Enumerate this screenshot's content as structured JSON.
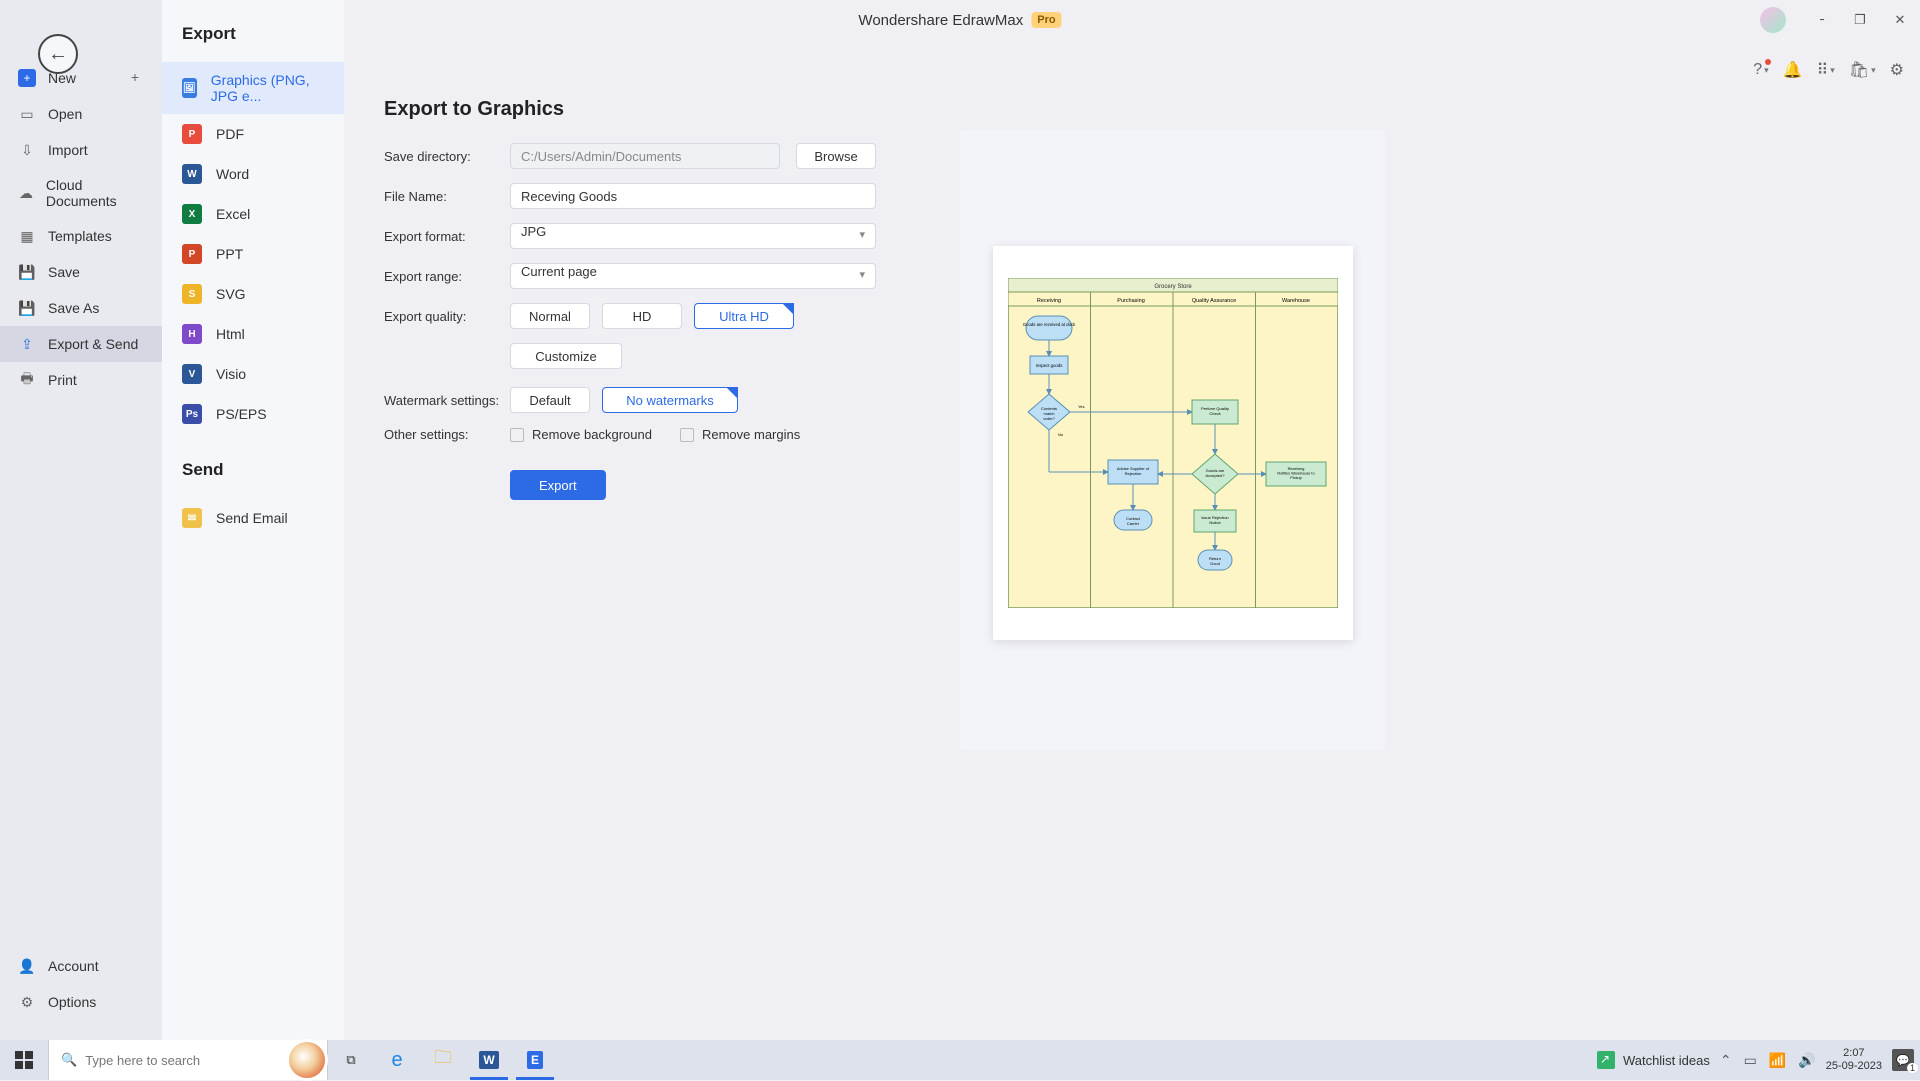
{
  "titlebar": {
    "app": "Wondershare EdrawMax",
    "badge": "Pro"
  },
  "back_aria": "Back",
  "leftnav": {
    "new": "New",
    "open": "Open",
    "import": "Import",
    "cloud": "Cloud Documents",
    "templates": "Templates",
    "save": "Save",
    "saveas": "Save As",
    "exportsend": "Export & Send",
    "print": "Print",
    "account": "Account",
    "options": "Options"
  },
  "typecol": {
    "export_heading": "Export",
    "graphics": "Graphics (PNG, JPG e...",
    "pdf": "PDF",
    "word": "Word",
    "excel": "Excel",
    "ppt": "PPT",
    "svg": "SVG",
    "html": "Html",
    "visio": "Visio",
    "pseps": "PS/EPS",
    "send_heading": "Send",
    "email": "Send Email"
  },
  "form": {
    "title": "Export to Graphics",
    "savedir_label": "Save directory:",
    "savedir_value": "C:/Users/Admin/Documents",
    "browse": "Browse",
    "filename_label": "File Name:",
    "filename_value": "Receving Goods",
    "format_label": "Export format:",
    "format_value": "JPG",
    "range_label": "Export range:",
    "range_value": "Current page",
    "quality_label": "Export quality:",
    "quality_normal": "Normal",
    "quality_hd": "HD",
    "quality_ultra": "Ultra HD",
    "customize": "Customize",
    "watermark_label": "Watermark settings:",
    "wm_default": "Default",
    "wm_none": "No watermarks",
    "other_label": "Other settings:",
    "remove_bg": "Remove background",
    "remove_margins": "Remove margins",
    "export_btn": "Export"
  },
  "preview": {
    "title": "Grocery Store",
    "lanes": [
      "Receiving",
      "Purchasing",
      "Quality Assurance",
      "Warehouse"
    ],
    "n_goods": "Goods are received at dock",
    "n_inspect": "Inspect goods",
    "n_match": "Contents match order?",
    "n_yes": "Yes",
    "n_no": "No",
    "n_advise": "Advise Supplier of Rejection",
    "n_contact": "Contact Carrier",
    "n_quality": "Perform Quality Check",
    "n_accepted": "Goods are Accepted?",
    "n_issue": "Issue Rejection Notice",
    "n_return": "Return Good",
    "n_wh": "Receiving Notifies Warehouse to Pickup"
  },
  "taskbar": {
    "search_placeholder": "Type here to search",
    "watchlist": "Watchlist ideas",
    "time": "2:07",
    "date": "25-09-2023"
  }
}
